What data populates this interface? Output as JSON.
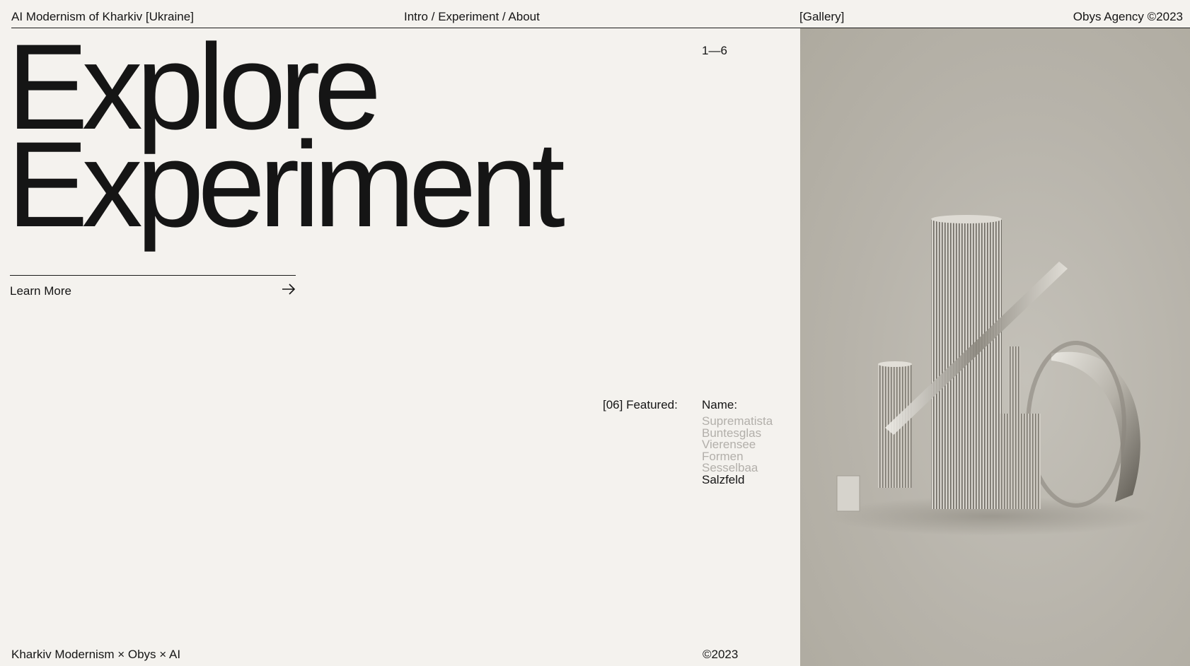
{
  "header": {
    "site_title": "AI Modernism of Kharkiv [Ukraine]",
    "nav": [
      "Intro",
      "Experiment",
      "About"
    ],
    "nav_separator": " / ",
    "gallery_link": "[Gallery]",
    "agency": "Obys Agency ©2023"
  },
  "hero": {
    "line1": "Explore",
    "line2": "Experiment"
  },
  "counter": "1—6",
  "cta": {
    "label": "Learn More",
    "icon": "arrow-right-icon"
  },
  "featured": {
    "label": "[06] Featured:",
    "names_title": "Name:",
    "names": [
      "Suprematista",
      "Buntesglas",
      "Vierensee",
      "Formen",
      "Sesselbaa",
      "Salzfeld"
    ],
    "active_index": 5
  },
  "footer": {
    "left": "Kharkiv Modernism × Obys × AI",
    "right": "©2023"
  },
  "colors": {
    "background": "#f4f2ee",
    "text": "#151515",
    "muted": "#b2afaa",
    "image_bg": "#b9b5ac"
  }
}
